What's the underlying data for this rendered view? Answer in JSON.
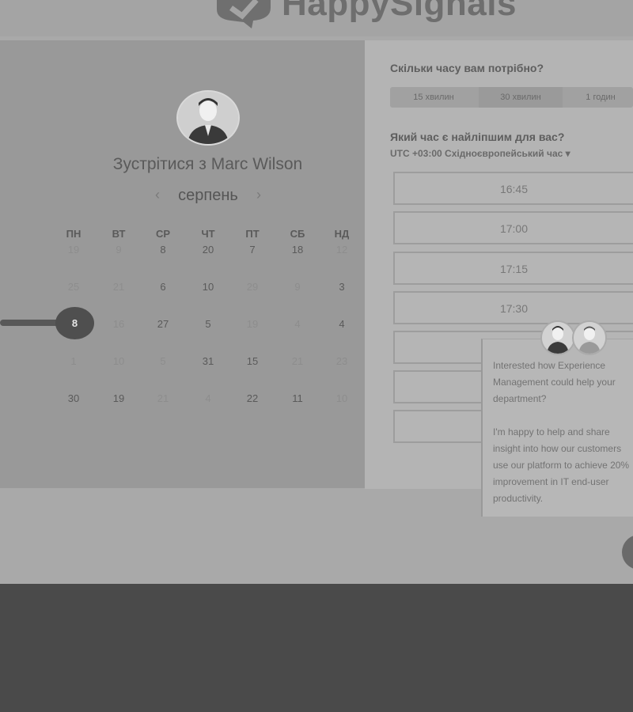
{
  "header": {
    "brand": "HappySignals"
  },
  "left": {
    "host_title": "Зустрітися з Marc Wilson",
    "month": "серпень",
    "prev_arrow": "‹",
    "next_arrow": "›",
    "weekdays": [
      "ПН",
      "ВТ",
      "СР",
      "ЧТ",
      "ПТ",
      "СБ",
      "НД"
    ],
    "selected_day": "8",
    "weeks": [
      [
        "19",
        "9",
        "8",
        "20",
        "7",
        "18",
        "12"
      ],
      [
        "25",
        "21",
        "6",
        "10",
        "29",
        "9",
        "3"
      ],
      [
        "",
        "16",
        "27",
        "5",
        "19",
        "4",
        "4"
      ],
      [
        "1",
        "10",
        "5",
        "31",
        "15",
        "21",
        "23"
      ],
      [
        "30",
        "19",
        "21",
        "4",
        "22",
        "11",
        "10"
      ]
    ]
  },
  "right": {
    "duration_question": "Скільки часу вам потрібно?",
    "durations": [
      "15 хвилин",
      "30 хвилин",
      "1 годин"
    ],
    "time_question": "Який час є найліпшим для вас?",
    "timezone": "UTC +03:00 Східноєвропейський час ▾",
    "slots": [
      "16:45",
      "17:00",
      "17:15",
      "17:30",
      "",
      "",
      ""
    ]
  },
  "chat": {
    "message_1": "Interested how Experience Management could help your department?",
    "message_2": "I'm happy to help and share insight into how our customers use our platform to achieve 20% improvement in IT end-user productivity."
  }
}
